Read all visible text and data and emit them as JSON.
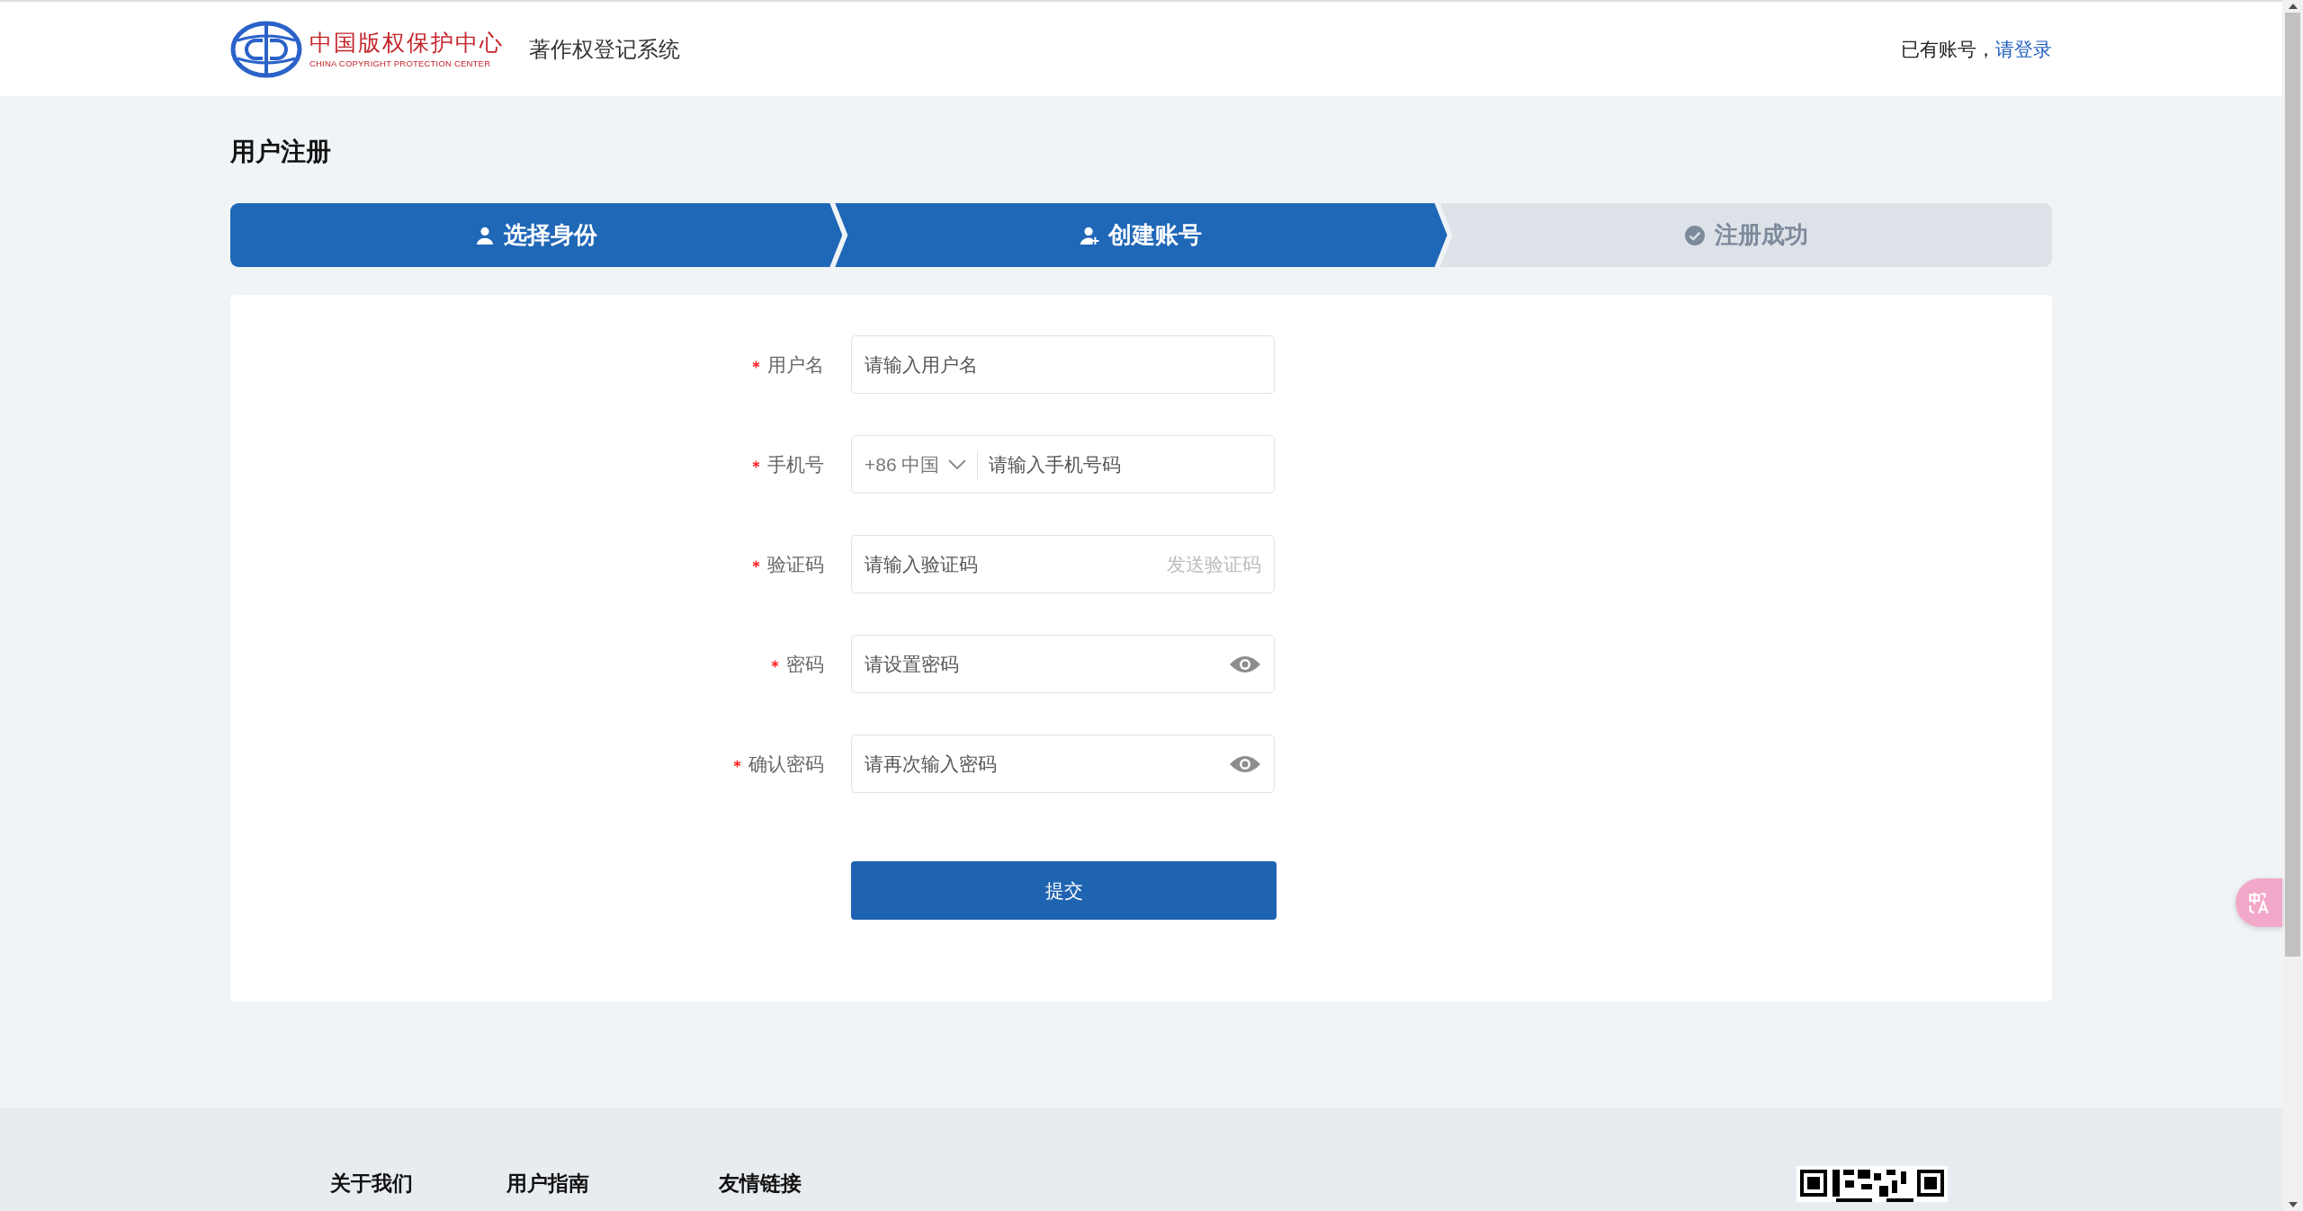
{
  "header": {
    "logo": {
      "name": "中国版权保护中心",
      "subtitle": "CHINA COPYRIGHT PROTECTION CENTER"
    },
    "system_name": "著作权登记系统",
    "account_prompt": "已有账号，",
    "login_link": "请登录"
  },
  "page_title": "用户注册",
  "steps": [
    {
      "label": "选择身份",
      "active": true
    },
    {
      "label": "创建账号",
      "active": true
    },
    {
      "label": "注册成功",
      "active": false
    }
  ],
  "form": {
    "fields": [
      {
        "kind": "text",
        "label": "用户名",
        "required": true,
        "placeholder": "请输入用户名"
      },
      {
        "kind": "phone",
        "label": "手机号",
        "required": true,
        "country_code": "+86 中国",
        "placeholder": "请输入手机号码"
      },
      {
        "kind": "code",
        "label": "验证码",
        "required": true,
        "placeholder": "请输入验证码",
        "action": "发送验证码"
      },
      {
        "kind": "password",
        "label": "密码",
        "required": true,
        "placeholder": "请设置密码"
      },
      {
        "kind": "password",
        "label": "确认密码",
        "required": true,
        "placeholder": "请再次输入密码"
      }
    ],
    "submit": "提交"
  },
  "footer": {
    "links": [
      "关于我们",
      "用户指南",
      "友情链接"
    ]
  }
}
